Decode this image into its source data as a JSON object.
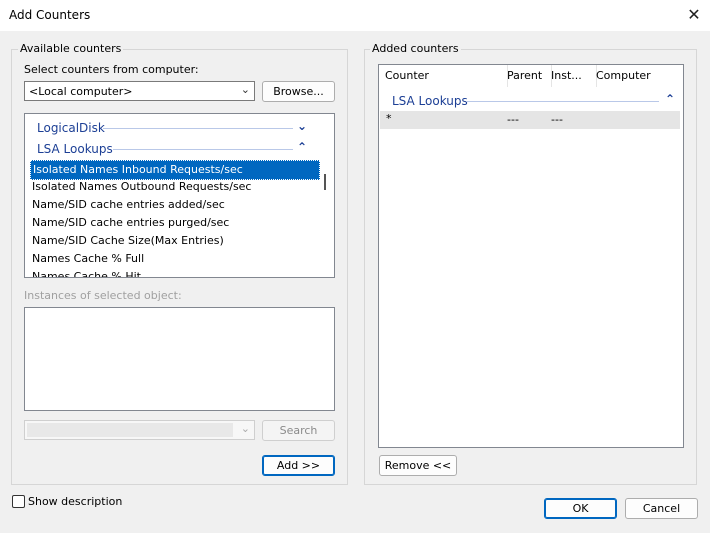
{
  "window": {
    "title": "Add Counters",
    "close_glyph": "✕"
  },
  "available": {
    "legend": "Available counters",
    "select_label": "Select counters from computer:",
    "computer_value": "<Local computer>",
    "browse_label": "Browse...",
    "categories": [
      {
        "label": "LogicalDisk",
        "chevron": "⌄"
      },
      {
        "label": "LSA Lookups",
        "chevron": "⌃"
      }
    ],
    "counters": [
      "Isolated Names Inbound Requests/sec",
      "Isolated Names Outbound Requests/sec",
      "Name/SID cache entries added/sec",
      "Name/SID cache entries purged/sec",
      "Name/SID Cache Size(Max Entries)",
      "Names Cache % Full",
      "Names Cache % Hit"
    ],
    "selected_index": 0,
    "instances_label": "Instances of selected object:",
    "search_value": "",
    "search_label": "Search",
    "add_label": "Add >>"
  },
  "added": {
    "legend": "Added counters",
    "columns": [
      "Counter",
      "Parent",
      "Inst...",
      "Computer"
    ],
    "category": {
      "label": "LSA Lookups",
      "chevron": "⌃"
    },
    "rows": [
      {
        "counter": "*",
        "parent": "---",
        "instance": "---",
        "computer": ""
      }
    ],
    "remove_label": "Remove <<"
  },
  "footer": {
    "show_description_label": "Show description",
    "show_description_checked": false,
    "ok_label": "OK",
    "cancel_label": "Cancel"
  },
  "colors": {
    "accent": "#0067c0",
    "category_text": "#1c3f95"
  }
}
